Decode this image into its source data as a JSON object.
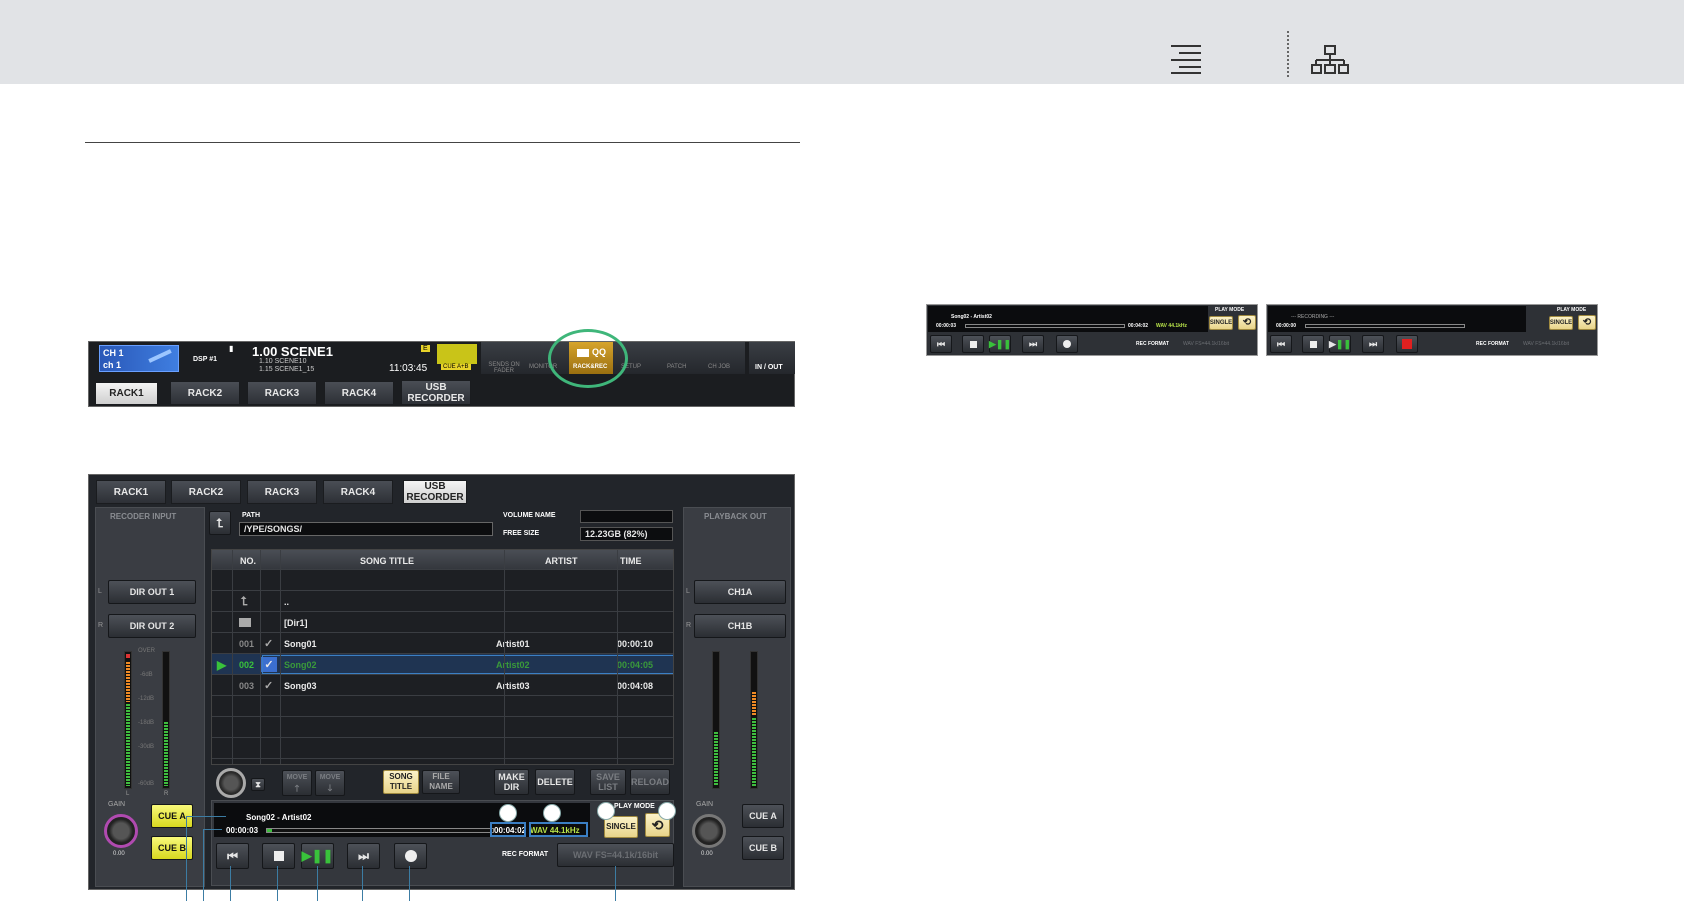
{
  "header": {
    "menu_icon": "menu-lines-icon",
    "sitemap_icon": "sitemap-icon"
  },
  "topscreen": {
    "channel": {
      "number": "CH 1",
      "name": "ch 1"
    },
    "dsp": "DSP #1",
    "scene": {
      "current": "1.00 SCENE1",
      "line2": "1.10  SCENE10",
      "line3": "1.15  SCENE1_15"
    },
    "clock": "11:03:45",
    "badge_e": "E",
    "cue_ab": "CUE A+B",
    "icons": [
      "SENDS ON FADER",
      "MONITOR",
      "RACK&REC",
      "SETUP",
      "PATCH",
      "CH JOB",
      "IN / OUT"
    ],
    "tabs": [
      "RACK1",
      "RACK2",
      "RACK3",
      "RACK4",
      "USB RECORDER"
    ]
  },
  "recorder": {
    "tabs": [
      "RACK1",
      "RACK2",
      "RACK3",
      "RACK4",
      "USB RECORDER"
    ],
    "left_title": "RECODER INPUT",
    "right_title": "PLAYBACK OUT",
    "inputs": [
      {
        "ch": "L",
        "label": "DIR OUT 1"
      },
      {
        "ch": "R",
        "label": "DIR OUT 2"
      }
    ],
    "outputs": [
      {
        "ch": "L",
        "label": "CH1A"
      },
      {
        "ch": "R",
        "label": "CH1B"
      }
    ],
    "meter_labels": [
      "OVER",
      "-6dB",
      "-12dB",
      "-18dB",
      "-30dB",
      "-60dB"
    ],
    "gain_label": "GAIN",
    "gain_value": "0.00",
    "meter_lr": [
      "L",
      "R"
    ],
    "cue": {
      "a": "CUE A",
      "b": "CUE B"
    },
    "path_label": "PATH",
    "path": "/YPE/SONGS/",
    "volume_name_label": "VOLUME NAME",
    "volume_name": "",
    "free_size_label": "FREE SIZE",
    "free_size": "12.23GB (82%)",
    "columns": [
      "NO.",
      "SONG TITLE",
      "ARTIST",
      "TIME"
    ],
    "rows": [
      {
        "no": "",
        "title": "..",
        "artist": "",
        "time": "",
        "icon": "up-arrow-icon"
      },
      {
        "no": "",
        "title": "[Dir1]",
        "artist": "",
        "time": "",
        "icon": "folder-icon"
      },
      {
        "no": "001",
        "title": "Song01",
        "artist": "Artist01",
        "time": "00:00:10",
        "icon": "check"
      },
      {
        "no": "002",
        "title": "Song02",
        "artist": "Artist02",
        "time": "00:04:05",
        "icon": "check",
        "selected": true
      },
      {
        "no": "003",
        "title": "Song03",
        "artist": "Artist03",
        "time": "00:04:08",
        "icon": "check"
      }
    ],
    "buttons": {
      "move_up": "MOVE",
      "move_down": "MOVE",
      "song_title": "SONG TITLE",
      "file_name": "FILE NAME",
      "make_dir": "MAKE DIR",
      "delete": "DELETE",
      "save_list": "SAVE LIST",
      "reload": "RELOAD"
    },
    "now_playing": "Song02 - Artist02",
    "elapsed": "00:00:03",
    "total": "00:04:02",
    "format": "WAV  44.1kHz",
    "progress": 0.02,
    "play_mode_label": "PLAY MODE",
    "single": "SINGLE",
    "rec_format_label": "REC FORMAT",
    "rec_format": "WAV FS=44.1k/16bit"
  },
  "mini_play": {
    "title": "Song02 - Artist02",
    "elapsed": "00:00:03",
    "total": "00:04:02",
    "format": "WAV  44.1kHz",
    "play_mode": "PLAY MODE",
    "single": "SINGLE",
    "rec_format_label": "REC FORMAT",
    "rec_format": "WAV FS=44.1k/16bit"
  },
  "mini_rec": {
    "title": "--- RECORDING ---",
    "elapsed": "00:00:00",
    "play_mode": "PLAY MODE",
    "single": "SINGLE",
    "rec_format_label": "REC FORMAT",
    "rec_format": "WAV FS=44.1k/16bit"
  },
  "colors": {
    "accent_green": "#3fb67a",
    "highlight_blue": "#3b7fc4",
    "play_green": "#39c23b",
    "record_red": "#e02020",
    "lit_yellow": "#f2f06a"
  }
}
